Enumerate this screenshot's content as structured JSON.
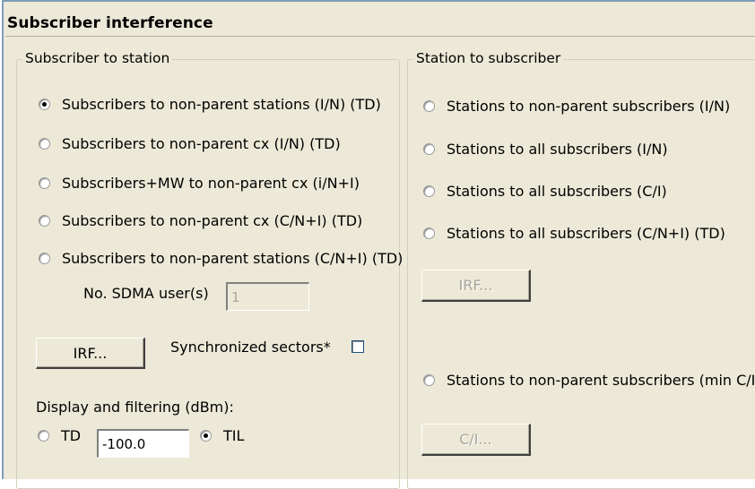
{
  "panel_title": "Subscriber interference",
  "left_group": {
    "title": "Subscriber to station",
    "options": [
      {
        "label": "Subscribers to non-parent stations (I/N) (TD)",
        "checked": true
      },
      {
        "label": "Subscribers to non-parent cx (I/N) (TD)",
        "checked": false
      },
      {
        "label": "Subscribers+MW to non-parent cx (i/N+I)",
        "checked": false
      },
      {
        "label": "Subscribers to non-parent cx (C/N+I) (TD)",
        "checked": false
      },
      {
        "label": "Subscribers to non-parent stations (C/N+I) (TD)",
        "checked": false
      }
    ],
    "sdma_label": "No. SDMA user(s)",
    "sdma_value": "1",
    "irf_button": "IRF...",
    "sync_label": "Synchronized sectors*",
    "sync_checked": false,
    "display_label": "Display and filtering (dBm):",
    "td_label": "TD",
    "td_value": "-100.0",
    "til_label": "TIL",
    "selected_mode": "TIL"
  },
  "right_group": {
    "title": "Station to subscriber",
    "options": [
      {
        "label": "Stations to non-parent subscribers (I/N)",
        "checked": false
      },
      {
        "label": "Stations to all subscribers (I/N)",
        "checked": false
      },
      {
        "label": "Stations to all subscribers (C/I)",
        "checked": false
      },
      {
        "label": "Stations to all subscribers (C/N+I) (TD)",
        "checked": false
      }
    ],
    "irf_button": "IRF...",
    "min_ci_option": {
      "label": "Stations to non-parent subscribers (min C/I)",
      "checked": false
    },
    "ci_button": "C/I..."
  }
}
